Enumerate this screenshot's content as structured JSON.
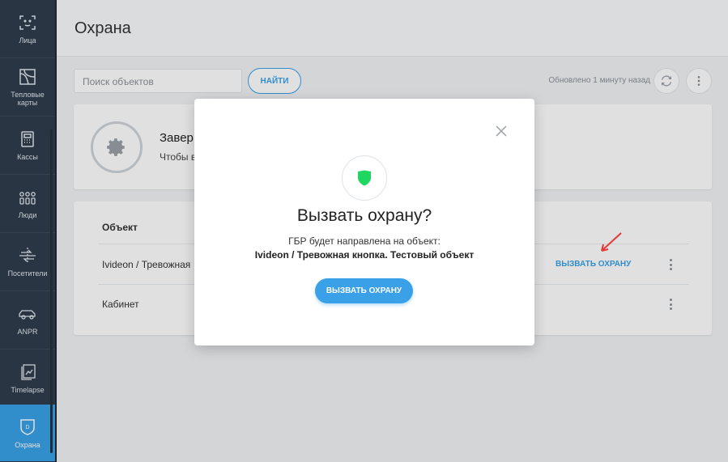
{
  "sidebar": {
    "items": [
      {
        "label": "Лица",
        "icon": "face-icon"
      },
      {
        "label": "Тепловые карты",
        "icon": "heatmap-icon"
      },
      {
        "label": "Кассы",
        "icon": "cash-register-icon"
      },
      {
        "label": "Люди",
        "icon": "people-icon"
      },
      {
        "label": "Посетители",
        "icon": "visitors-icon"
      },
      {
        "label": "ANPR",
        "icon": "car-icon"
      },
      {
        "label": "Timelapse",
        "icon": "timelapse-icon"
      },
      {
        "label": "Охрана",
        "icon": "guard-shield-icon",
        "badge": "D"
      }
    ],
    "active": "Охрана",
    "accent": "#3aa1e8"
  },
  "header": {
    "title": "Охрана"
  },
  "toolbar": {
    "search_placeholder": "Поиск объектов",
    "find_label": "НАЙТИ",
    "updated_text": "Обновлено 1 минуту назад"
  },
  "info_card": {
    "title": "Завер",
    "subtitle": "Чтобы в"
  },
  "table": {
    "header": "Объект",
    "rows": [
      {
        "name": "Ivideon / Тревожная",
        "action": "ВЫЗВАТЬ ОХРАНУ"
      },
      {
        "name": "Кабинет",
        "action": ""
      }
    ]
  },
  "modal": {
    "title": "Вызвать охрану?",
    "subtitle": "ГБР будет направлена на объект:",
    "object": "Ivideon / Тревожная кнопка. Тестовый объект",
    "button_label": "ВЫЗВАТЬ ОХРАНУ",
    "shield_color": "#1ed760"
  }
}
